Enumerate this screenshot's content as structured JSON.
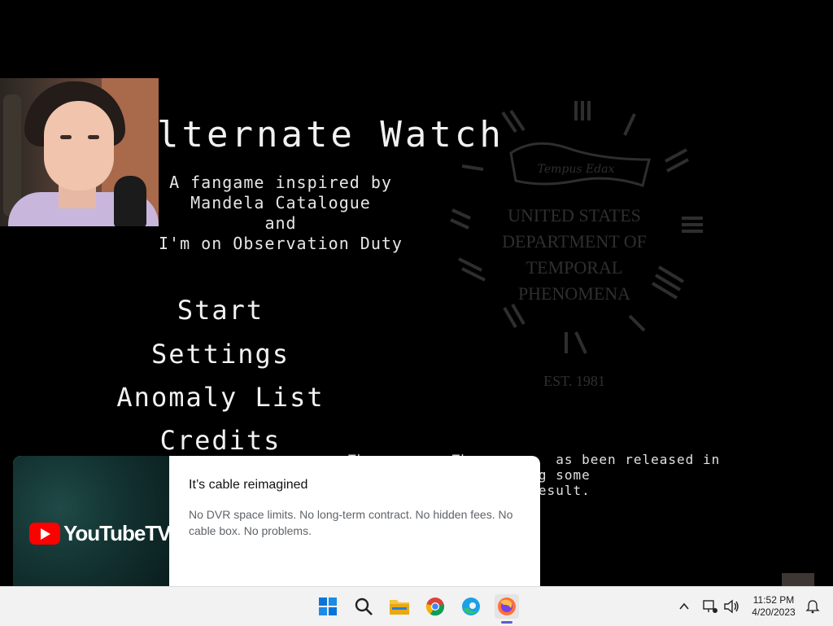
{
  "game": {
    "title": "lternate Watch",
    "subtitle_lines": [
      "A fangame inspired by",
      "Mandela Catalogue",
      "and",
      "I'm on Observation Duty"
    ],
    "menu": [
      "Start",
      "Settings",
      "Anomaly List",
      "Credits"
    ],
    "notice_lines": [
      "Th          Th          as been released in",
      "          nd is missing some",
      "          glish as a result."
    ],
    "emblem": {
      "line1": "UNITED STATES",
      "line2": "DEPARTMENT OF",
      "line3": "TEMPORAL",
      "line4": "PHENOMENA",
      "est": "EST. 1981",
      "banner_text": "Tempus Edax",
      "top_numeral": "XII",
      "bottom_numeral": "VI"
    }
  },
  "ad": {
    "brand": "YouTubeTV",
    "headline": "It’s cable reimagined",
    "body": "No DVR space limits. No long-term contract. No hidden fees. No cable box. No problems."
  },
  "taskbar": {
    "icons": [
      "windows-start-icon",
      "search-icon",
      "file-explorer-icon",
      "chrome-icon",
      "edge-icon",
      "firefox-icon"
    ],
    "time": "11:52 PM",
    "date": "4/20/2023"
  },
  "colors": {
    "ad_red": "#ff0000",
    "taskbar_bg": "#f2f2f2",
    "game_bg": "#000000"
  }
}
